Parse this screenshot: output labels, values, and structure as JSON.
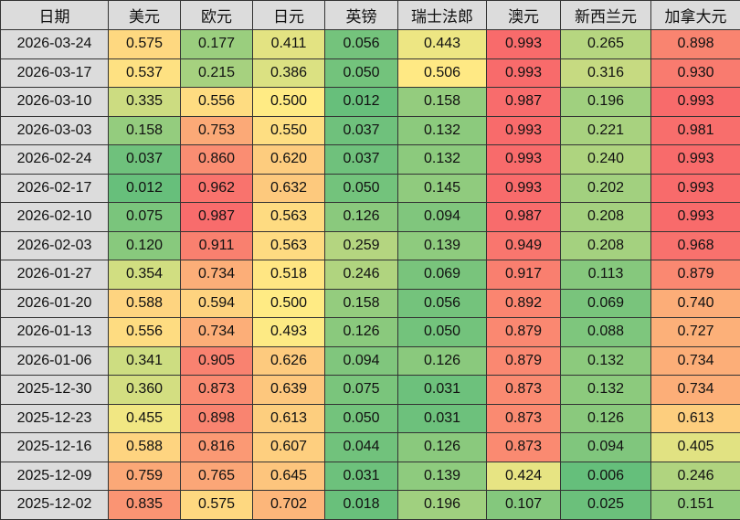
{
  "chart_data": {
    "type": "heatmap",
    "title": "",
    "color_scale": {
      "min": 0,
      "mid": 0.5,
      "max": 1,
      "low_color": "#63BE7B",
      "mid_color": "#FFEB84",
      "high_color": "#F8696B"
    },
    "header_color": "#DCDCDC",
    "columns": [
      "日期",
      "美元",
      "欧元",
      "日元",
      "英镑",
      "瑞士法郎",
      "澳元",
      "新西兰元",
      "加拿大元"
    ],
    "rows": [
      {
        "date": "2026-03-24",
        "values": [
          "0.575",
          "0.177",
          "0.411",
          "0.056",
          "0.443",
          "0.993",
          "0.265",
          "0.898"
        ]
      },
      {
        "date": "2026-03-17",
        "values": [
          "0.537",
          "0.215",
          "0.386",
          "0.050",
          "0.506",
          "0.993",
          "0.316",
          "0.930"
        ]
      },
      {
        "date": "2026-03-10",
        "values": [
          "0.335",
          "0.556",
          "0.500",
          "0.012",
          "0.158",
          "0.987",
          "0.196",
          "0.993"
        ]
      },
      {
        "date": "2026-03-03",
        "values": [
          "0.158",
          "0.753",
          "0.550",
          "0.037",
          "0.132",
          "0.993",
          "0.221",
          "0.981"
        ]
      },
      {
        "date": "2026-02-24",
        "values": [
          "0.037",
          "0.860",
          "0.620",
          "0.037",
          "0.132",
          "0.993",
          "0.240",
          "0.993"
        ]
      },
      {
        "date": "2026-02-17",
        "values": [
          "0.012",
          "0.962",
          "0.632",
          "0.050",
          "0.145",
          "0.993",
          "0.202",
          "0.993"
        ]
      },
      {
        "date": "2026-02-10",
        "values": [
          "0.075",
          "0.987",
          "0.563",
          "0.126",
          "0.094",
          "0.987",
          "0.208",
          "0.993"
        ]
      },
      {
        "date": "2026-02-03",
        "values": [
          "0.120",
          "0.911",
          "0.563",
          "0.259",
          "0.139",
          "0.949",
          "0.208",
          "0.968"
        ]
      },
      {
        "date": "2026-01-27",
        "values": [
          "0.354",
          "0.734",
          "0.518",
          "0.246",
          "0.069",
          "0.917",
          "0.113",
          "0.879"
        ]
      },
      {
        "date": "2026-01-20",
        "values": [
          "0.588",
          "0.594",
          "0.500",
          "0.158",
          "0.056",
          "0.892",
          "0.069",
          "0.740"
        ]
      },
      {
        "date": "2026-01-13",
        "values": [
          "0.556",
          "0.734",
          "0.493",
          "0.126",
          "0.050",
          "0.879",
          "0.088",
          "0.727"
        ]
      },
      {
        "date": "2026-01-06",
        "values": [
          "0.341",
          "0.905",
          "0.626",
          "0.094",
          "0.126",
          "0.879",
          "0.132",
          "0.734"
        ]
      },
      {
        "date": "2025-12-30",
        "values": [
          "0.360",
          "0.873",
          "0.639",
          "0.075",
          "0.031",
          "0.873",
          "0.132",
          "0.734"
        ]
      },
      {
        "date": "2025-12-23",
        "values": [
          "0.455",
          "0.898",
          "0.613",
          "0.050",
          "0.031",
          "0.873",
          "0.126",
          "0.613"
        ]
      },
      {
        "date": "2025-12-16",
        "values": [
          "0.588",
          "0.816",
          "0.607",
          "0.044",
          "0.126",
          "0.873",
          "0.094",
          "0.405"
        ]
      },
      {
        "date": "2025-12-09",
        "values": [
          "0.759",
          "0.765",
          "0.645",
          "0.031",
          "0.139",
          "0.424",
          "0.006",
          "0.246"
        ]
      },
      {
        "date": "2025-12-02",
        "values": [
          "0.835",
          "0.575",
          "0.702",
          "0.018",
          "0.196",
          "0.107",
          "0.025",
          "0.151"
        ]
      }
    ]
  }
}
